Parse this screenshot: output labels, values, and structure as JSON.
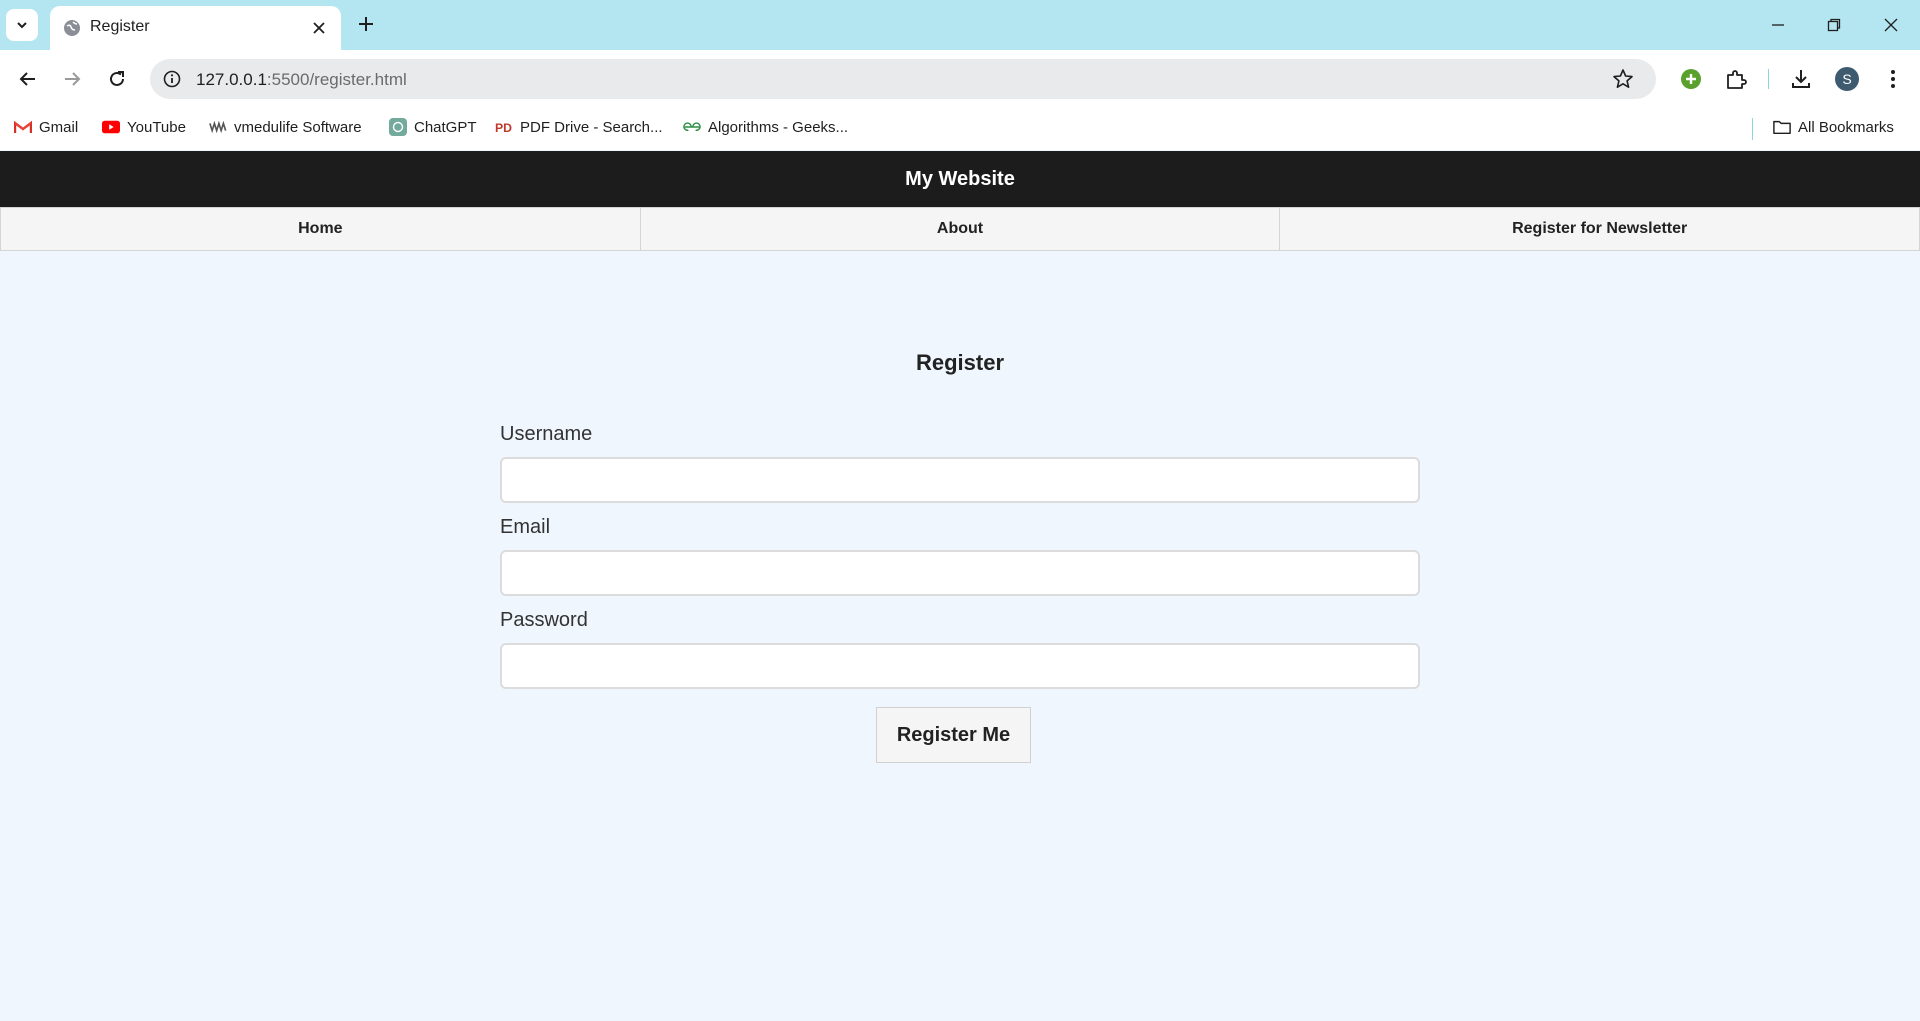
{
  "browser": {
    "tab_title": "Register",
    "url_host": "127.0.0.1",
    "url_path": ":5500/register.html",
    "profile_initial": "S",
    "bookmarks": [
      {
        "label": "Gmail",
        "icon": "gmail-icon"
      },
      {
        "label": "YouTube",
        "icon": "youtube-icon"
      },
      {
        "label": "vmedulife Software",
        "icon": "vmedulife-icon"
      },
      {
        "label": "ChatGPT",
        "icon": "chatgpt-icon"
      },
      {
        "label": "PDF Drive - Search...",
        "icon": "pdfdrive-icon"
      },
      {
        "label": "Algorithms - Geeks...",
        "icon": "geeksforgeeks-icon"
      }
    ],
    "all_bookmarks": "All Bookmarks"
  },
  "site": {
    "title": "My Website",
    "nav": [
      {
        "label": "Home"
      },
      {
        "label": "About"
      },
      {
        "label": "Register for Newsletter"
      }
    ]
  },
  "form": {
    "title": "Register",
    "fields": [
      {
        "label": "Username",
        "value": ""
      },
      {
        "label": "Email",
        "value": ""
      },
      {
        "label": "Password",
        "value": ""
      }
    ],
    "submit_label": "Register Me"
  },
  "colors": {
    "tabstrip": "#b4e6f1",
    "page_bg": "#eff6fe",
    "header_bg": "#1c1c1c",
    "nav_bg": "#f5f5f5"
  }
}
